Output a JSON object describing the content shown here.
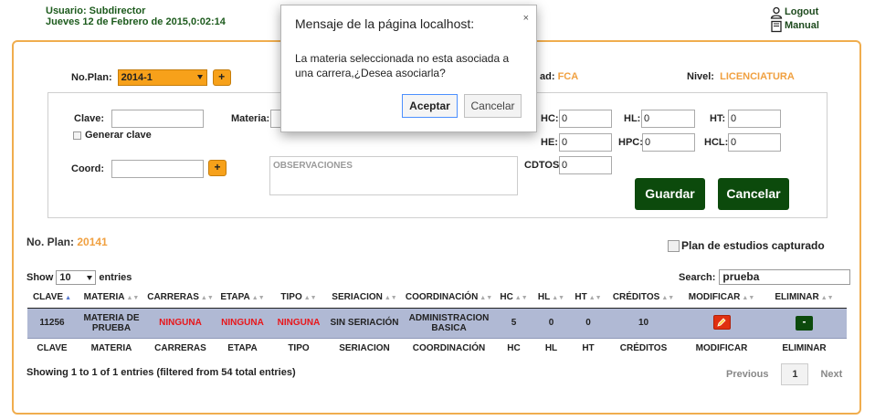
{
  "header": {
    "user_line": "Usuario: Subdirector",
    "date_line": "Jueves 12 de Febrero de 2015,0:02:14",
    "logout": "Logout",
    "manual": "Manual"
  },
  "form": {
    "plan_label": "No.Plan:",
    "plan_value": "2014-1",
    "plus": "+",
    "unidad_label": "ad:",
    "unidad_value": "FCA",
    "nivel_label": "Nivel:",
    "nivel_value": "LICENCIATURA",
    "clave_label": "Clave:",
    "clave_value": "",
    "generar_clave": "Generar clave",
    "materia_label": "Materia:",
    "coord_label": "Coord:",
    "coord_value": "",
    "obs_placeholder": "OBSERVACIONES",
    "hc_label": "HC:",
    "hc": "0",
    "hl_label": "HL:",
    "hl": "0",
    "ht_label": "HT:",
    "ht": "0",
    "he_label": "HE:",
    "he": "0",
    "hpc_label": "HPC:",
    "hpc": "0",
    "hcl_label": "HCL:",
    "hcl": "0",
    "cdtos_label": "CDTOS:",
    "cdtos": "0",
    "guardar": "Guardar",
    "cancelar": "Cancelar"
  },
  "summary": {
    "noplan_label": "No. Plan:",
    "noplan_value": "20141",
    "plan_capturado": "Plan de estudios capturado"
  },
  "table_controls": {
    "show": "Show",
    "entries_value": "10",
    "entries": "entries",
    "search_label": "Search:",
    "search_value": "prueba"
  },
  "table": {
    "columns": [
      "CLAVE",
      "MATERIA",
      "CARRERAS",
      "ETAPA",
      "TIPO",
      "SERIACION",
      "COORDINACIÓN",
      "HC",
      "HL",
      "HT",
      "CRÉDITOS",
      "MODIFICAR",
      "ELIMINAR"
    ],
    "sort_asc": "▲",
    "sort_both": "▲▼",
    "row": {
      "clave": "11256",
      "materia": "MATERIA DE PRUEBA",
      "carreras": "NINGUNA",
      "etapa": "NINGUNA",
      "tipo": "NINGUNA",
      "seriacion": "SIN SERIACIÓN",
      "coordinacion": "ADMINISTRACION BASICA",
      "hc": "5",
      "hl": "0",
      "ht": "0",
      "creditos": "10",
      "eliminar": "-"
    }
  },
  "footer": {
    "info": "Showing 1 to 1 of 1 entries (filtered from 54 total entries)",
    "previous": "Previous",
    "page": "1",
    "next": "Next"
  },
  "dialog": {
    "title": "Mensaje de la página localhost:",
    "close": "×",
    "message": "La materia seleccionada no esta asociada a una carrera,¿Desea asociarla?",
    "accept": "Aceptar",
    "cancel": "Cancelar"
  },
  "colors": {
    "accent_orange": "#f7a11a",
    "dark_green": "#0c4a0c",
    "row_highlight": "#b0b9d4",
    "alert_red": "#e8161a"
  }
}
